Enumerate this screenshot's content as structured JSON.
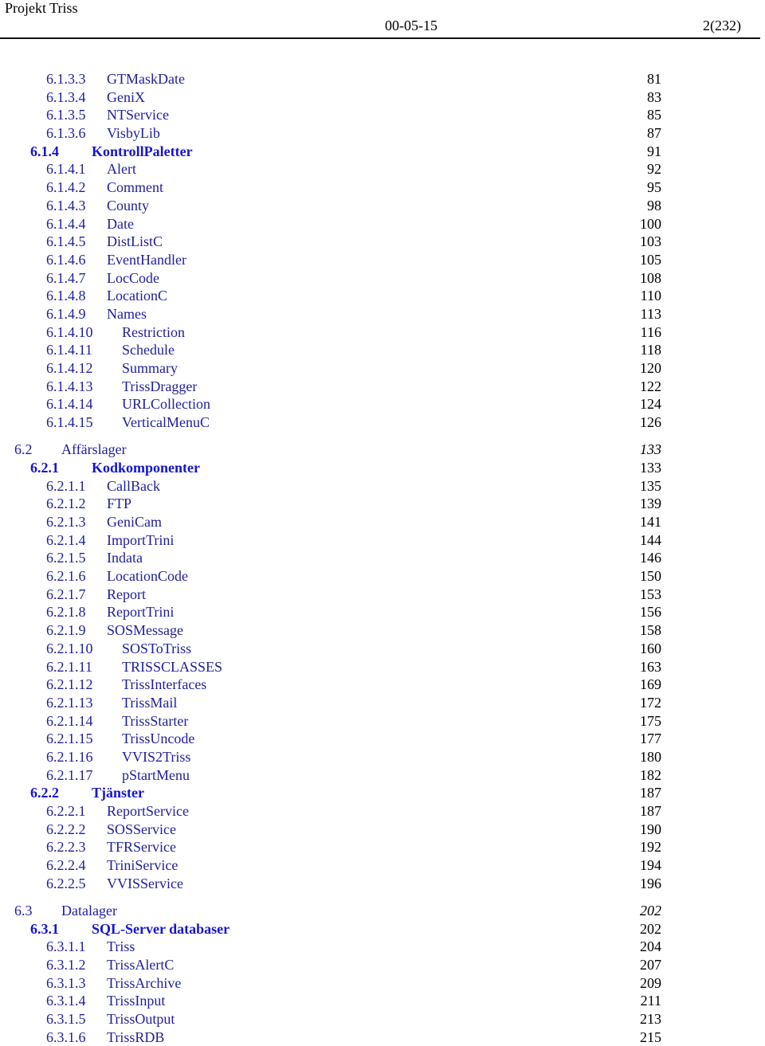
{
  "header": {
    "title": "Projekt Triss",
    "date": "00-05-15",
    "page": "2(232)"
  },
  "colors": {
    "level2": "#1c1ca8",
    "level3": "#1414d4",
    "level4": "#1e1e9e",
    "page_numbers": "#000000"
  },
  "toc": [
    {
      "level": 4,
      "number": "6.1.3.3",
      "title": "GTMaskDate",
      "page": "81"
    },
    {
      "level": 4,
      "number": "6.1.3.4",
      "title": "GeniX",
      "page": "83"
    },
    {
      "level": 4,
      "number": "6.1.3.5",
      "title": "NTService",
      "page": "85"
    },
    {
      "level": 4,
      "number": "6.1.3.6",
      "title": "VisbyLib",
      "page": "87"
    },
    {
      "level": 3,
      "number": "6.1.4",
      "title": "KontrollPaletter",
      "page": "91"
    },
    {
      "level": 4,
      "number": "6.1.4.1",
      "title": "Alert",
      "page": "92"
    },
    {
      "level": 4,
      "number": "6.1.4.2",
      "title": "Comment",
      "page": "95"
    },
    {
      "level": 4,
      "number": "6.1.4.3",
      "title": "County",
      "page": "98"
    },
    {
      "level": 4,
      "number": "6.1.4.4",
      "title": "Date",
      "page": "100"
    },
    {
      "level": 4,
      "number": "6.1.4.5",
      "title": "DistListC",
      "page": "103"
    },
    {
      "level": 4,
      "number": "6.1.4.6",
      "title": "EventHandler",
      "page": "105"
    },
    {
      "level": 4,
      "number": "6.1.4.7",
      "title": "LocCode",
      "page": "108"
    },
    {
      "level": 4,
      "number": "6.1.4.8",
      "title": "LocationC",
      "page": "110"
    },
    {
      "level": 4,
      "number": "6.1.4.9",
      "title": "Names",
      "page": "113"
    },
    {
      "level": 4,
      "number": "6.1.4.10",
      "title": "Restriction",
      "page": "116"
    },
    {
      "level": 4,
      "number": "6.1.4.11",
      "title": "Schedule",
      "page": "118"
    },
    {
      "level": 4,
      "number": "6.1.4.12",
      "title": "Summary",
      "page": "120"
    },
    {
      "level": 4,
      "number": "6.1.4.13",
      "title": "TrissDragger",
      "page": "122"
    },
    {
      "level": 4,
      "number": "6.1.4.14",
      "title": "URLCollection",
      "page": "124"
    },
    {
      "level": 4,
      "number": "6.1.4.15",
      "title": "VerticalMenuC",
      "page": "126"
    },
    {
      "level": 2,
      "number": "6.2",
      "title": "Affärslager",
      "page": "133"
    },
    {
      "level": 3,
      "number": "6.2.1",
      "title": "Kodkomponenter",
      "page": "133"
    },
    {
      "level": 4,
      "number": "6.2.1.1",
      "title": "CallBack",
      "page": "135"
    },
    {
      "level": 4,
      "number": "6.2.1.2",
      "title": "FTP",
      "page": "139"
    },
    {
      "level": 4,
      "number": "6.2.1.3",
      "title": "GeniCam",
      "page": "141"
    },
    {
      "level": 4,
      "number": "6.2.1.4",
      "title": "ImportTrini",
      "page": "144"
    },
    {
      "level": 4,
      "number": "6.2.1.5",
      "title": "Indata",
      "page": "146"
    },
    {
      "level": 4,
      "number": "6.2.1.6",
      "title": "LocationCode",
      "page": "150"
    },
    {
      "level": 4,
      "number": "6.2.1.7",
      "title": "Report",
      "page": "153"
    },
    {
      "level": 4,
      "number": "6.2.1.8",
      "title": "ReportTrini",
      "page": "156"
    },
    {
      "level": 4,
      "number": "6.2.1.9",
      "title": "SOSMessage",
      "page": "158"
    },
    {
      "level": 4,
      "number": "6.2.1.10",
      "title": "SOSToTriss",
      "page": "160"
    },
    {
      "level": 4,
      "number": "6.2.1.11",
      "title": "TRISSCLASSES",
      "page": "163"
    },
    {
      "level": 4,
      "number": "6.2.1.12",
      "title": "TrissInterfaces",
      "page": "169"
    },
    {
      "level": 4,
      "number": "6.2.1.13",
      "title": "TrissMail",
      "page": "172"
    },
    {
      "level": 4,
      "number": "6.2.1.14",
      "title": "TrissStarter",
      "page": "175"
    },
    {
      "level": 4,
      "number": "6.2.1.15",
      "title": "TrissUncode",
      "page": "177"
    },
    {
      "level": 4,
      "number": "6.2.1.16",
      "title": "VVIS2Triss",
      "page": "180"
    },
    {
      "level": 4,
      "number": "6.2.1.17",
      "title": "pStartMenu",
      "page": "182"
    },
    {
      "level": 3,
      "number": "6.2.2",
      "title": "Tjänster",
      "page": "187"
    },
    {
      "level": 4,
      "number": "6.2.2.1",
      "title": "ReportService",
      "page": "187"
    },
    {
      "level": 4,
      "number": "6.2.2.2",
      "title": "SOSService",
      "page": "190"
    },
    {
      "level": 4,
      "number": "6.2.2.3",
      "title": "TFRService",
      "page": "192"
    },
    {
      "level": 4,
      "number": "6.2.2.4",
      "title": "TriniService",
      "page": "194"
    },
    {
      "level": 4,
      "number": "6.2.2.5",
      "title": "VVISService",
      "page": "196"
    },
    {
      "level": 2,
      "number": "6.3",
      "title": "Datalager",
      "page": "202"
    },
    {
      "level": 3,
      "number": "6.3.1",
      "title": "SQL-Server databaser",
      "page": "202"
    },
    {
      "level": 4,
      "number": "6.3.1.1",
      "title": "Triss",
      "page": "204"
    },
    {
      "level": 4,
      "number": "6.3.1.2",
      "title": "TrissAlertC",
      "page": "207"
    },
    {
      "level": 4,
      "number": "6.3.1.3",
      "title": "TrissArchive",
      "page": "209"
    },
    {
      "level": 4,
      "number": "6.3.1.4",
      "title": "TrissInput",
      "page": "211"
    },
    {
      "level": 4,
      "number": "6.3.1.5",
      "title": "TrissOutput",
      "page": "213"
    },
    {
      "level": 4,
      "number": "6.3.1.6",
      "title": "TrissRDB",
      "page": "215"
    }
  ]
}
